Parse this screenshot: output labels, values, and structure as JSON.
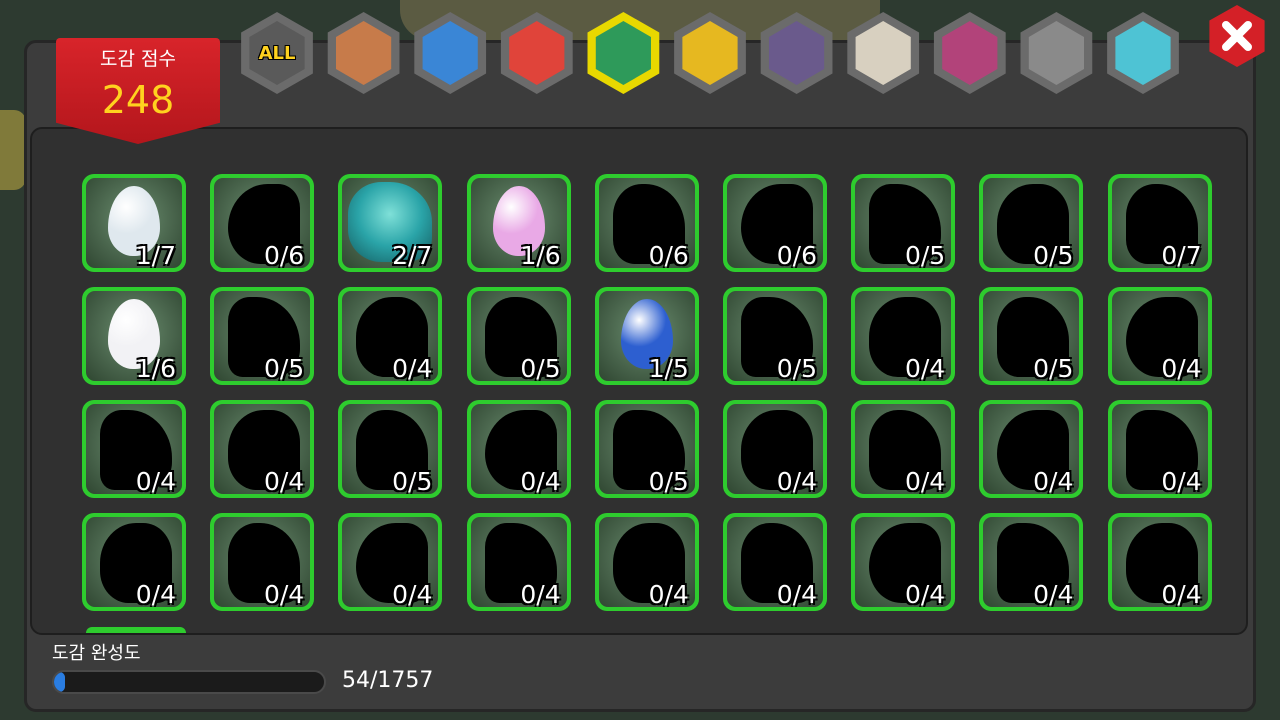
{
  "score": {
    "label": "도감 점수",
    "value": "248"
  },
  "tabs": [
    {
      "id": "all",
      "text": "ALL",
      "icon": "all-text-icon",
      "color": "#6b6b6b"
    },
    {
      "id": "earth",
      "text": "",
      "icon": "earth-element-icon",
      "color": "#c77b4a"
    },
    {
      "id": "water",
      "text": "",
      "icon": "water-drop-icon",
      "color": "#3a86d6"
    },
    {
      "id": "fire",
      "text": "",
      "icon": "fire-element-icon",
      "color": "#e0443a"
    },
    {
      "id": "wind",
      "text": "",
      "icon": "wind-tornado-icon",
      "color": "#2e9a5a"
    },
    {
      "id": "light",
      "text": "",
      "icon": "light-sun-icon",
      "color": "#e6b820"
    },
    {
      "id": "dark",
      "text": "",
      "icon": "dark-dragon-icon",
      "color": "#6a5a8c"
    },
    {
      "id": "spirit",
      "text": "",
      "icon": "spirit-swirl-icon",
      "color": "#d8d0c0"
    },
    {
      "id": "chaos",
      "text": "",
      "icon": "chaos-element-icon",
      "color": "#b2437a"
    },
    {
      "id": "void",
      "text": "",
      "icon": "void-element-icon",
      "color": "#8a8a8a"
    },
    {
      "id": "rainbow",
      "text": "",
      "icon": "rainbow-element-icon",
      "color": "#4ec3d4"
    }
  ],
  "active_tab": "wind",
  "cells": [
    {
      "count": "1/7",
      "kind": "egg",
      "color": "#dfe8ee"
    },
    {
      "count": "0/6",
      "kind": "silhouette"
    },
    {
      "count": "2/7",
      "kind": "dragon",
      "color": "#2aa4a8"
    },
    {
      "count": "1/6",
      "kind": "egg",
      "color": "#e9a9e6"
    },
    {
      "count": "0/6",
      "kind": "silhouette"
    },
    {
      "count": "0/6",
      "kind": "silhouette"
    },
    {
      "count": "0/5",
      "kind": "silhouette"
    },
    {
      "count": "0/5",
      "kind": "silhouette"
    },
    {
      "count": "0/7",
      "kind": "silhouette"
    },
    {
      "count": "1/6",
      "kind": "egg",
      "color": "#f2f2f5"
    },
    {
      "count": "0/5",
      "kind": "silhouette"
    },
    {
      "count": "0/4",
      "kind": "silhouette"
    },
    {
      "count": "0/5",
      "kind": "silhouette"
    },
    {
      "count": "1/5",
      "kind": "egg",
      "color": "#2d5fd0"
    },
    {
      "count": "0/5",
      "kind": "silhouette"
    },
    {
      "count": "0/4",
      "kind": "silhouette"
    },
    {
      "count": "0/5",
      "kind": "silhouette"
    },
    {
      "count": "0/4",
      "kind": "silhouette"
    },
    {
      "count": "0/4",
      "kind": "silhouette"
    },
    {
      "count": "0/4",
      "kind": "silhouette"
    },
    {
      "count": "0/5",
      "kind": "silhouette"
    },
    {
      "count": "0/4",
      "kind": "silhouette"
    },
    {
      "count": "0/5",
      "kind": "silhouette"
    },
    {
      "count": "0/4",
      "kind": "silhouette"
    },
    {
      "count": "0/4",
      "kind": "silhouette"
    },
    {
      "count": "0/4",
      "kind": "silhouette"
    },
    {
      "count": "0/4",
      "kind": "silhouette"
    },
    {
      "count": "0/4",
      "kind": "silhouette"
    },
    {
      "count": "0/4",
      "kind": "silhouette"
    },
    {
      "count": "0/4",
      "kind": "silhouette"
    },
    {
      "count": "0/4",
      "kind": "silhouette"
    },
    {
      "count": "0/4",
      "kind": "silhouette"
    },
    {
      "count": "0/4",
      "kind": "silhouette"
    },
    {
      "count": "0/4",
      "kind": "silhouette"
    },
    {
      "count": "0/4",
      "kind": "silhouette"
    },
    {
      "count": "0/4",
      "kind": "silhouette"
    }
  ],
  "completion": {
    "label": "도감 완성도",
    "text": "54/1757",
    "collected": 54,
    "total": 1757
  },
  "colors": {
    "cell_border": "#2ecc2e",
    "score_banner": "#d8242a",
    "score_value": "#ffd21f",
    "active_tab": "#e8d800",
    "close": "#d42027"
  }
}
